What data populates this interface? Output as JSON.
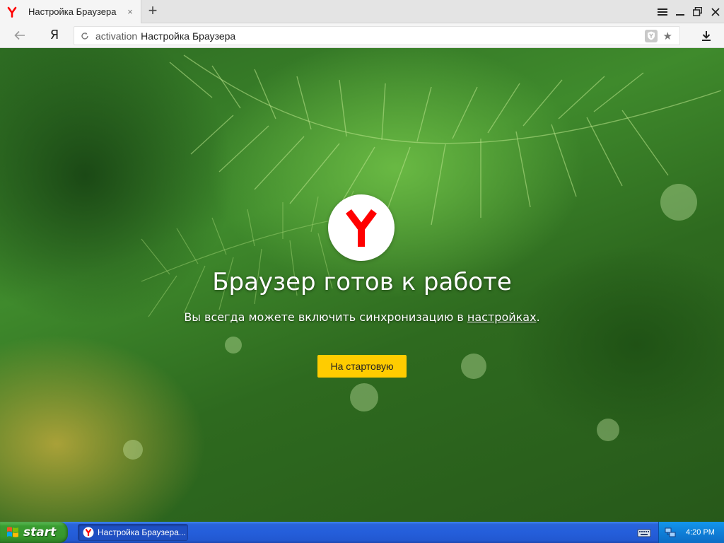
{
  "browser": {
    "tab": {
      "title": "Настройка Браузера",
      "close_glyph": "×"
    },
    "new_tab_glyph": "+",
    "address_bar": {
      "scheme": "activation",
      "page_title": "Настройка Браузера"
    },
    "ya_button_label": "Я",
    "bookmark_glyph": "★"
  },
  "page": {
    "headline": "Браузер готов к работе",
    "subline_prefix": "Вы всегда можете включить синхронизацию в ",
    "subline_link": "настройках",
    "subline_suffix": ".",
    "start_button_label": "На стартовую"
  },
  "taskbar": {
    "start_label": "start",
    "task_label": "Настройка Браузера...",
    "clock": "4:20 PM"
  },
  "colors": {
    "yandex_red": "#ff0000",
    "button_yellow": "#ffcc00",
    "xp_blue": "#245edb",
    "xp_green": "#3a9d31"
  },
  "icons": {
    "tab_favicon": "yandex-browser-icon",
    "back": "arrow-left-icon",
    "reload": "reload-icon",
    "protect": "protect-shield-icon",
    "bookmark": "star-icon",
    "download": "download-icon",
    "menu": "hamburger-icon",
    "minimize": "minimize-icon",
    "restore": "restore-icon",
    "close": "close-icon"
  }
}
